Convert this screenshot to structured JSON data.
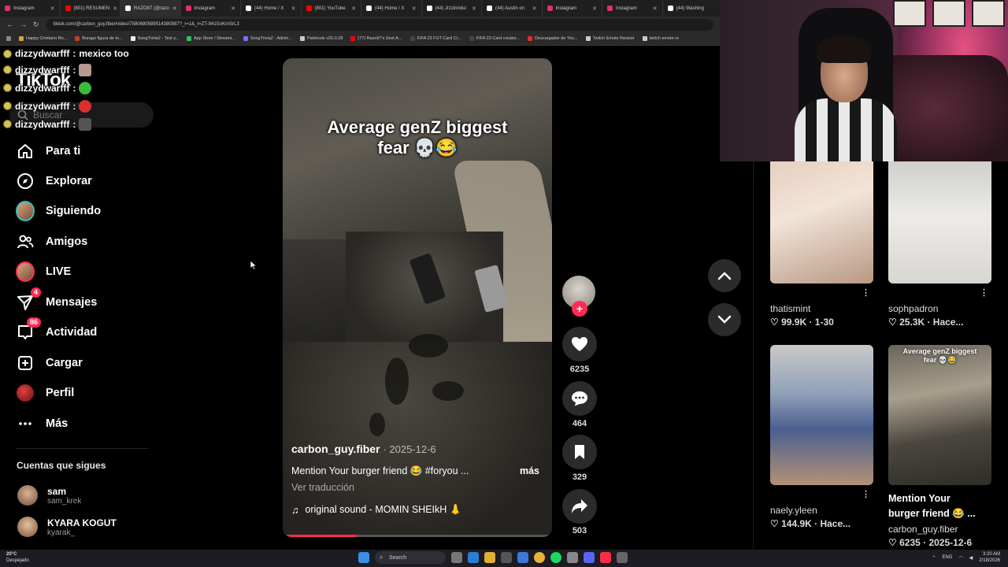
{
  "browser": {
    "tabs": [
      "Instagram",
      "(801) RESUMEN",
      "RAZO97 (@razo",
      "Instagram",
      "(44) Home / X",
      "(801) YouTube",
      "(44) Home / X",
      "(44) Jrzzin#dui",
      "(44) Austin on",
      "Instagram",
      "Instagram",
      "(44) Washing"
    ],
    "url": "tiktok.com/@carbon_guy.fiber/video/7580680589514380987?_r=1&_t=ZT-941SoKmSrL3",
    "bookmarks": [
      "Happy Cristiano Ro...",
      "Burago figura de to...",
      "SongTrivia2 - Test y...",
      "App Store / Streami...",
      "SongTrivia2 - Adivin...",
      "Paletools v26.0.28",
      "(77) Razo97's Zest-A...",
      "FIFA 23 FUT Card Cr...",
      "FIFA 23 Card creator...",
      "Descargador de You...",
      "Twitch Emote Resizer",
      "twitch emote re"
    ]
  },
  "chat": {
    "lines": [
      {
        "user": "dizzydwarfff",
        "msg": "mexico too"
      },
      {
        "user": "dizzydwarfff",
        "msg": ""
      },
      {
        "user": "dizzydwarfff",
        "msg": ""
      },
      {
        "user": "dizzydwarfff",
        "msg": ""
      },
      {
        "user": "dizzydwarfff",
        "msg": ""
      }
    ]
  },
  "sidebar": {
    "logo": "TikTok",
    "search_placeholder": "Buscar",
    "items": [
      {
        "label": "Para ti",
        "icon": "home-icon"
      },
      {
        "label": "Explorar",
        "icon": "compass-icon"
      },
      {
        "label": "Siguiendo",
        "icon": "following-avatar"
      },
      {
        "label": "Amigos",
        "icon": "friends-icon"
      },
      {
        "label": "LIVE",
        "icon": "live-avatar"
      },
      {
        "label": "Mensajes",
        "icon": "messages-icon",
        "badge": "4"
      },
      {
        "label": "Actividad",
        "icon": "activity-icon",
        "badge": "86"
      },
      {
        "label": "Cargar",
        "icon": "upload-icon"
      },
      {
        "label": "Perfil",
        "icon": "profile-avatar"
      },
      {
        "label": "Más",
        "icon": "more-icon"
      }
    ],
    "following_title": "Cuentas que sigues",
    "following": [
      {
        "name": "sam",
        "handle": "sam_krek"
      },
      {
        "name": "KYARA KOGUT",
        "handle": "kyarak_"
      }
    ]
  },
  "video": {
    "overlay_text_line1": "Average genZ biggest",
    "overlay_text_line2": "fear 💀😂",
    "author": "carbon_guy.fiber",
    "date": "· 2025-12-6",
    "description": "Mention Your burger friend 😂 #foryou ...",
    "more": "más",
    "translate": "Ver traducción",
    "sound": "original sound - MOMIN SHEIkH 👃",
    "progress": 0.27
  },
  "actions": {
    "likes": "6235",
    "comments": "464",
    "saves": "329",
    "shares": "503"
  },
  "grid": [
    {
      "user": "thatismint",
      "stats": "♡ 99.9K · 1-30"
    },
    {
      "user": "sophpadron",
      "stats": "♡ 25.3K · Hace..."
    },
    {
      "user": "naely.yleen",
      "stats": "♡ 144.9K · Hace..."
    },
    {
      "title_line1": "Mention Your",
      "title_line2": "burger friend 😂 ...",
      "user": "carbon_guy.fiber",
      "stats": "♡ 6235 · 2025-12-6",
      "thumb_text_line1": "Average genZ biggest",
      "thumb_text_line2": "fear 💀😂"
    }
  ],
  "taskbar": {
    "weather_temp": "20°C",
    "weather_desc": "Despejado",
    "search": "Search",
    "lang": "ENG",
    "time": "3:20 AM",
    "date": "2/18/2026"
  },
  "colors": {
    "accent": "#fe2c55",
    "background": "#000000"
  }
}
